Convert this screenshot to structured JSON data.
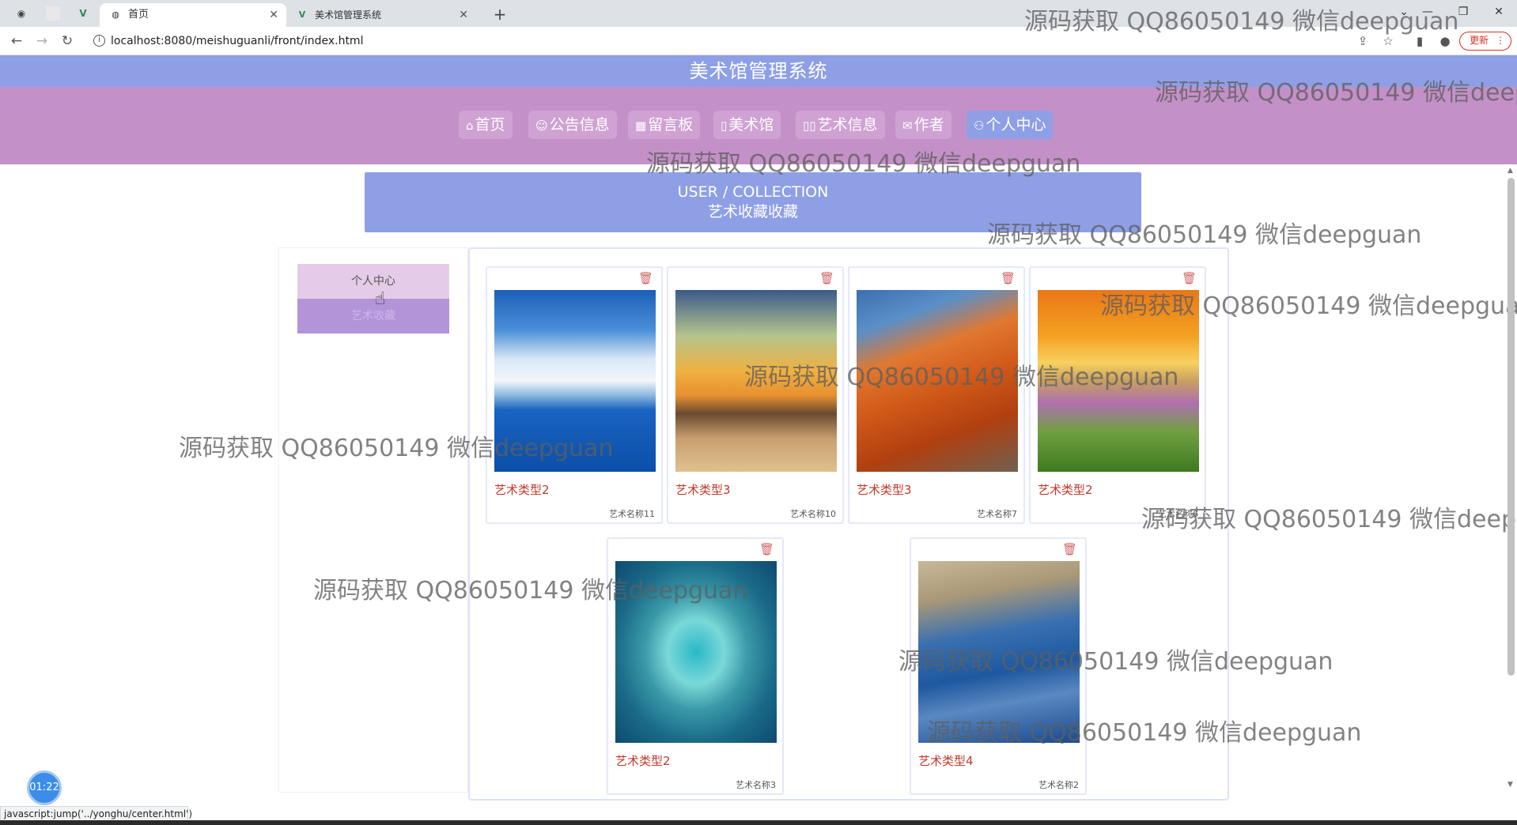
{
  "browser": {
    "tabs": [
      {
        "title": "首页",
        "active": true
      },
      {
        "title": "美术馆管理系统",
        "active": false
      }
    ],
    "new_tab": "+",
    "url": "localhost:8080/meishuguanli/front/index.html",
    "update_label": "更新",
    "status_text": "javascript:jump('../yonghu/center.html')"
  },
  "site": {
    "title": "美术馆管理系统",
    "nav": [
      {
        "label": "首页",
        "icon": "home-icon",
        "active": false
      },
      {
        "label": "公告信息",
        "icon": "announcement-icon",
        "active": false
      },
      {
        "label": "留言板",
        "icon": "message-board-icon",
        "active": false
      },
      {
        "label": "美术馆",
        "icon": "gallery-icon",
        "active": false
      },
      {
        "label": "艺术信息",
        "icon": "art-info-icon",
        "active": false
      },
      {
        "label": "作者",
        "icon": "author-icon",
        "active": false
      },
      {
        "label": "个人中心",
        "icon": "user-icon",
        "active": true
      }
    ]
  },
  "banner": {
    "en": "USER / COLLECTION",
    "zh": "艺术收藏收藏"
  },
  "sidebar": {
    "items": [
      {
        "label": "个人中心"
      },
      {
        "label": "艺术收藏"
      }
    ]
  },
  "cards": [
    {
      "type": "艺术类型2",
      "name": "艺术名称11"
    },
    {
      "type": "艺术类型3",
      "name": "艺术名称10"
    },
    {
      "type": "艺术类型3",
      "name": "艺术名称7"
    },
    {
      "type": "艺术类型2",
      "name": "艺术名称6"
    },
    {
      "type": "艺术类型2",
      "name": "艺术名称3"
    },
    {
      "type": "艺术类型4",
      "name": "艺术名称2"
    }
  ],
  "watermark": "源码获取 QQ86050149 微信deepguan",
  "timer": "01:22",
  "colors": {
    "header": "#8e9fe6",
    "nav": "#c490c8",
    "accent_red": "#c0392b"
  }
}
